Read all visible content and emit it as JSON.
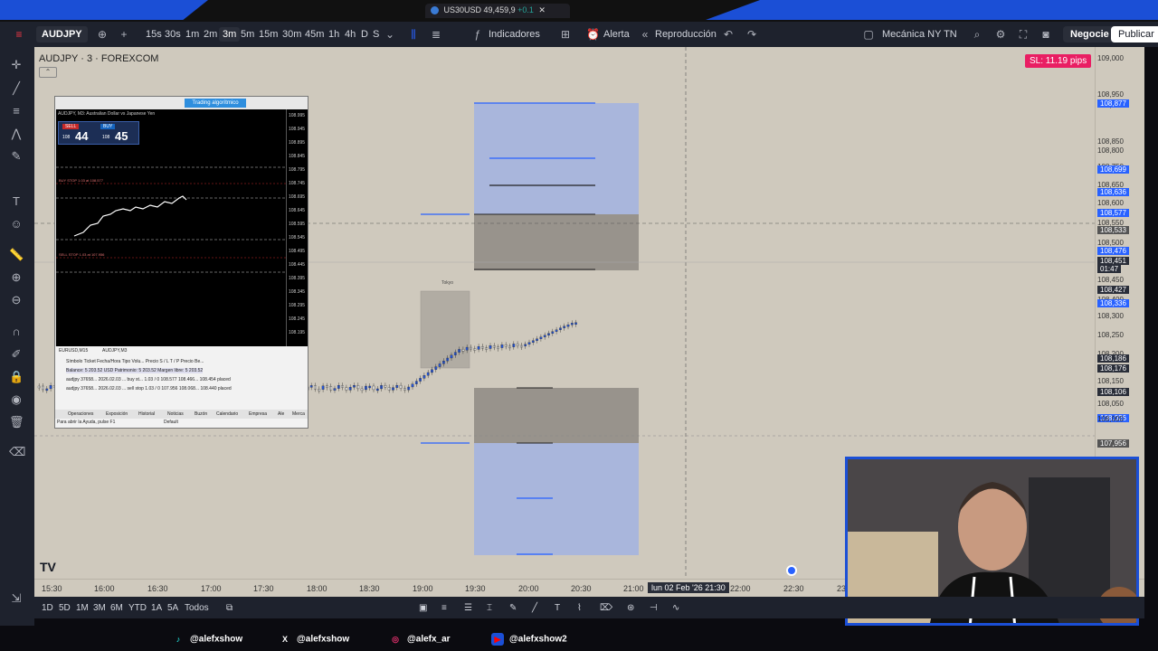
{
  "browser_tab": {
    "title": "US30USD",
    "value": "49,459,9",
    "change": "+0.1"
  },
  "toolbar": {
    "symbol": "AUDJPY",
    "intervals": [
      "15s",
      "30s",
      "1m",
      "2m",
      "3m",
      "5m",
      "15m",
      "30m",
      "45m",
      "1h",
      "4h",
      "D",
      "S"
    ],
    "active_interval": "3m",
    "indicators_label": "Indicadores",
    "alert_label": "Alerta",
    "replay_label": "Reproducción",
    "layout_name": "Mecánica NY TN",
    "trade_label": "Negocie",
    "publish_label": "Publicar"
  },
  "chart": {
    "title": "AUDJPY · 3 · FOREXCOM",
    "sl_badge": "SL: 11.19 pips",
    "session_label": "Tokyo"
  },
  "price_axis": {
    "labels": [
      {
        "text": "109,000",
        "style": "plain"
      },
      {
        "text": "108,950",
        "style": "plain"
      },
      {
        "text": "108,900",
        "style": "plain"
      },
      {
        "text": "108,877",
        "style": "blue"
      },
      {
        "text": "108,850",
        "style": "plain"
      },
      {
        "text": "108,800",
        "style": "plain"
      },
      {
        "text": "108,750",
        "style": "plain"
      },
      {
        "text": "108,699",
        "style": "blue"
      },
      {
        "text": "108,650",
        "style": "plain"
      },
      {
        "text": "108,636",
        "style": "blue"
      },
      {
        "text": "108,600",
        "style": "plain"
      },
      {
        "text": "108,577",
        "style": "blue"
      },
      {
        "text": "108,550",
        "style": "plain"
      },
      {
        "text": "108,533",
        "style": "gray"
      },
      {
        "text": "108,500",
        "style": "plain"
      },
      {
        "text": "108,476",
        "style": "blue"
      },
      {
        "text": "108,451",
        "style": "dark"
      },
      {
        "text": "01:47",
        "style": "dark"
      },
      {
        "text": "108,450",
        "style": "plain"
      },
      {
        "text": "108,427",
        "style": "dark"
      },
      {
        "text": "108,400",
        "style": "plain"
      },
      {
        "text": "108,336",
        "style": "blue"
      },
      {
        "text": "108,300",
        "style": "plain"
      },
      {
        "text": "108,250",
        "style": "plain"
      },
      {
        "text": "108,200",
        "style": "plain"
      },
      {
        "text": "108,186",
        "style": "dark"
      },
      {
        "text": "108,176",
        "style": "dark"
      },
      {
        "text": "108,150",
        "style": "plain"
      },
      {
        "text": "108,106",
        "style": "dark"
      },
      {
        "text": "108,050",
        "style": "plain"
      },
      {
        "text": "108,026",
        "style": "blue"
      },
      {
        "text": "108,000",
        "style": "plain"
      },
      {
        "text": "107,956",
        "style": "gray"
      }
    ]
  },
  "time_axis": {
    "labels": [
      "15:30",
      "16:00",
      "16:30",
      "17:00",
      "17:30",
      "18:00",
      "18:30",
      "19:00",
      "19:30",
      "20:00",
      "20:30",
      "21:00",
      "22:00",
      "22:30",
      "23"
    ],
    "cursor_label": "lun 02 Feb '26  21:30"
  },
  "bottombar": {
    "ranges": [
      "1D",
      "5D",
      "1M",
      "3M",
      "6M",
      "YTD",
      "1A",
      "5A",
      "Todos"
    ]
  },
  "mt": {
    "header": "AUDJPY, M3: Australian Dollar vs Japanese Yen",
    "tab_label": "Trading algorítmico",
    "bid_big": "44",
    "bid_prefix": "108",
    "bid_sup": "8",
    "ask_big": "45",
    "ask_prefix": "108",
    "ask_sup": "4",
    "buy_stop": "BUY STOP 1.03 at 108.577",
    "sell_stop": "SELL STOP 1.03 at 107.956",
    "axis": [
      "108.995",
      "108.945",
      "108.895",
      "108.845",
      "108.795",
      "108.745",
      "108.695",
      "108.645",
      "108.595",
      "108.545",
      "108.495",
      "108.445",
      "108.395",
      "108.345",
      "108.295",
      "108.245",
      "108.195"
    ],
    "symbol_tabs": [
      "EURUSD,M15",
      "AUDJPY,M3"
    ],
    "columns": "Símbolo   Ticket   Fecha/Hora   Tipo   Volu...   Precio   S / L   T / P   Precio   Be...",
    "balance": "Balance: 5 203.52 USD  Patrimonio: 5 203.52  Margen libre: 5 203.52",
    "order1": "audjpy  37658...  2026.02.03 ...  buy st...  1.03 / 0  108.577 108.466...  108.454  placed",
    "order2": "audjpy  37658...  2026.02.03 ...  sell stop  1.03 / 0  107.956 108.068...  108.440  placed",
    "bottom_tabs": [
      "Operaciones",
      "Exposición",
      "Historial",
      "Noticias",
      "Buzón",
      "Calendario",
      "Empresa",
      "Ale",
      "Merca"
    ],
    "status": "Para abrir la Ayuda, pulse F1",
    "status_profile": "Default"
  },
  "social": [
    {
      "icon": "tiktok-icon",
      "handle": "@alefxshow",
      "color": "#25f4ee"
    },
    {
      "icon": "x-icon",
      "handle": "@alefxshow",
      "color": "#ffffff"
    },
    {
      "icon": "instagram-icon",
      "handle": "@alefx_ar",
      "color": "#e1306c"
    },
    {
      "icon": "youtube-icon",
      "handle": "@alefxshow2",
      "color": "#ff0000"
    }
  ],
  "colors": {
    "chart_bg": "#cfc9bd",
    "candle_blue": "#2962ff",
    "zone_blue": "#a9b6dc",
    "zone_gray": "#9e9a93",
    "sl_badge": "#e91e63",
    "brand_blue": "#1b4fd6"
  }
}
